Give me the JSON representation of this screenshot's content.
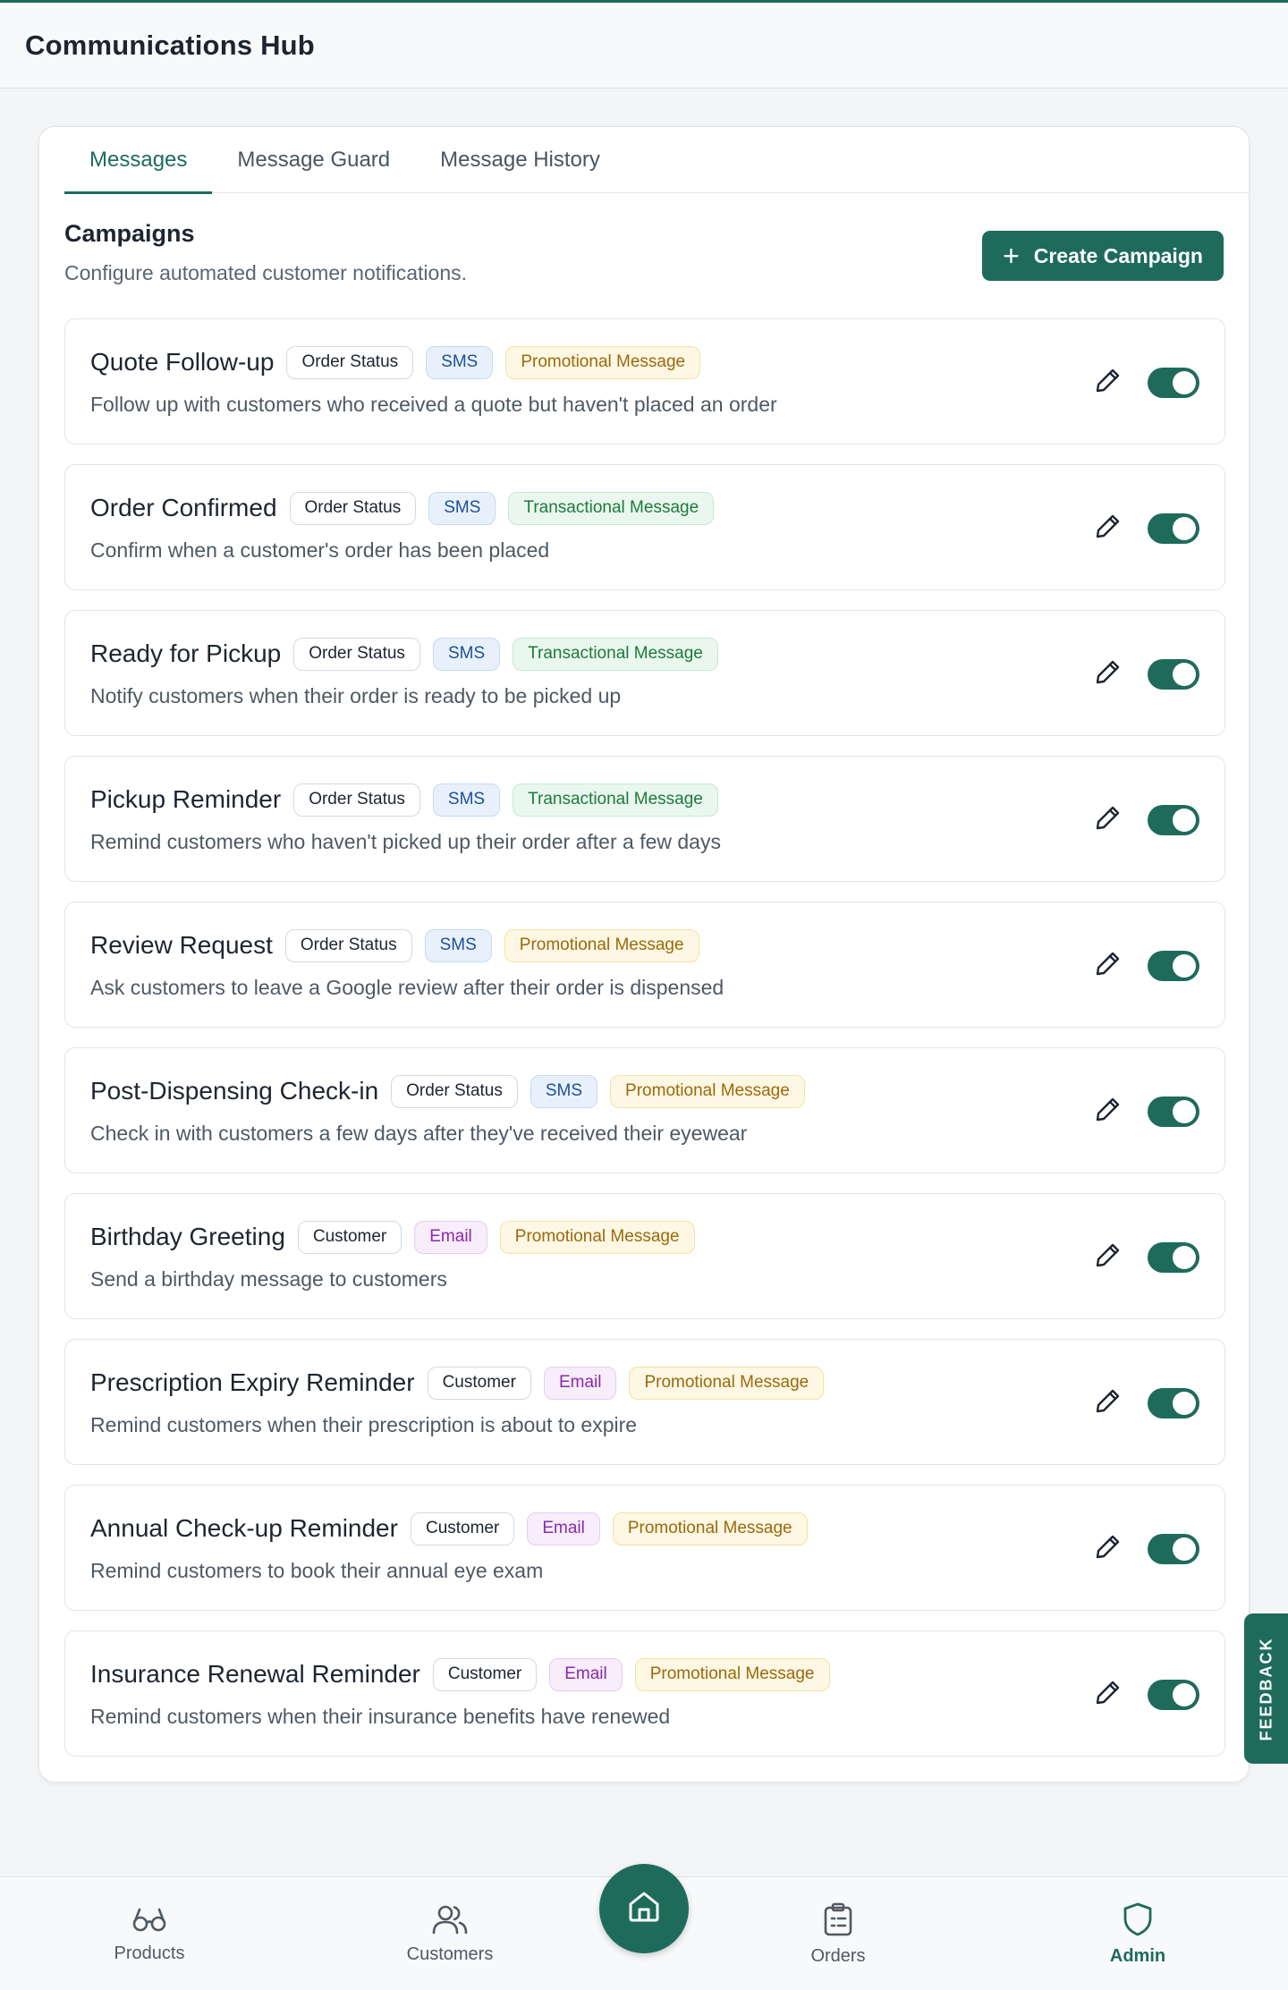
{
  "header": {
    "title": "Communications Hub"
  },
  "tabs": [
    {
      "label": "Messages",
      "active": true
    },
    {
      "label": "Message Guard",
      "active": false
    },
    {
      "label": "Message History",
      "active": false
    }
  ],
  "section": {
    "title": "Campaigns",
    "subtitle": "Configure automated customer notifications.",
    "create_label": "Create Campaign"
  },
  "campaigns": [
    {
      "name": "Quote Follow-up",
      "badges": [
        {
          "text": "Order Status",
          "kind": "kind"
        },
        {
          "text": "SMS",
          "kind": "sms"
        },
        {
          "text": "Promotional Message",
          "kind": "promo"
        }
      ],
      "description": "Follow up with customers who received a quote but haven't placed an order",
      "enabled": true
    },
    {
      "name": "Order Confirmed",
      "badges": [
        {
          "text": "Order Status",
          "kind": "kind"
        },
        {
          "text": "SMS",
          "kind": "sms"
        },
        {
          "text": "Transactional Message",
          "kind": "trans"
        }
      ],
      "description": "Confirm when a customer's order has been placed",
      "enabled": true
    },
    {
      "name": "Ready for Pickup",
      "badges": [
        {
          "text": "Order Status",
          "kind": "kind"
        },
        {
          "text": "SMS",
          "kind": "sms"
        },
        {
          "text": "Transactional Message",
          "kind": "trans"
        }
      ],
      "description": "Notify customers when their order is ready to be picked up",
      "enabled": true
    },
    {
      "name": "Pickup Reminder",
      "badges": [
        {
          "text": "Order Status",
          "kind": "kind"
        },
        {
          "text": "SMS",
          "kind": "sms"
        },
        {
          "text": "Transactional Message",
          "kind": "trans"
        }
      ],
      "description": "Remind customers who haven't picked up their order after a few days",
      "enabled": true
    },
    {
      "name": "Review Request",
      "badges": [
        {
          "text": "Order Status",
          "kind": "kind"
        },
        {
          "text": "SMS",
          "kind": "sms"
        },
        {
          "text": "Promotional Message",
          "kind": "promo"
        }
      ],
      "description": "Ask customers to leave a Google review after their order is dispensed",
      "enabled": true
    },
    {
      "name": "Post-Dispensing Check-in",
      "badges": [
        {
          "text": "Order Status",
          "kind": "kind"
        },
        {
          "text": "SMS",
          "kind": "sms"
        },
        {
          "text": "Promotional Message",
          "kind": "promo"
        }
      ],
      "description": "Check in with customers a few days after they've received their eyewear",
      "enabled": true
    },
    {
      "name": "Birthday Greeting",
      "badges": [
        {
          "text": "Customer",
          "kind": "kind"
        },
        {
          "text": "Email",
          "kind": "email"
        },
        {
          "text": "Promotional Message",
          "kind": "promo"
        }
      ],
      "description": "Send a birthday message to customers",
      "enabled": true
    },
    {
      "name": "Prescription Expiry Reminder",
      "badges": [
        {
          "text": "Customer",
          "kind": "kind"
        },
        {
          "text": "Email",
          "kind": "email"
        },
        {
          "text": "Promotional Message",
          "kind": "promo"
        }
      ],
      "description": "Remind customers when their prescription is about to expire",
      "enabled": true
    },
    {
      "name": "Annual Check-up Reminder",
      "badges": [
        {
          "text": "Customer",
          "kind": "kind"
        },
        {
          "text": "Email",
          "kind": "email"
        },
        {
          "text": "Promotional Message",
          "kind": "promo"
        }
      ],
      "description": "Remind customers to book their annual eye exam",
      "enabled": true
    },
    {
      "name": "Insurance Renewal Reminder",
      "badges": [
        {
          "text": "Customer",
          "kind": "kind"
        },
        {
          "text": "Email",
          "kind": "email"
        },
        {
          "text": "Promotional Message",
          "kind": "promo"
        }
      ],
      "description": "Remind customers when their insurance benefits have renewed",
      "enabled": true
    }
  ],
  "feedback": {
    "label": "FEEDBACK"
  },
  "bottom_nav": {
    "products": "Products",
    "customers": "Customers",
    "orders": "Orders",
    "admin": "Admin"
  },
  "colors": {
    "accent": "#1e6b5c"
  },
  "icons": {
    "edit": "pencil-icon",
    "products": "glasses-icon",
    "customers": "users-icon",
    "home": "home-icon",
    "orders": "clipboard-icon",
    "admin": "shield-icon"
  }
}
